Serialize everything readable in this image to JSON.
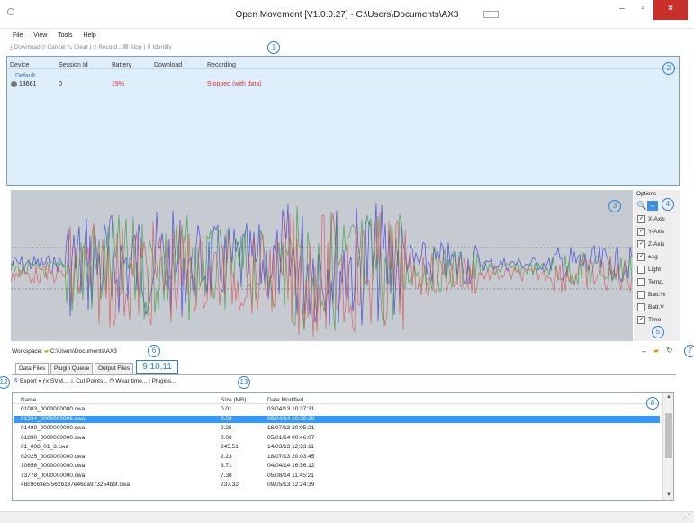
{
  "window": {
    "title": "Open Movement  [V1.0.0.27] - C:\\Users\\Documents\\AX3",
    "minimize": "–",
    "maximize": "▫",
    "close": "×"
  },
  "menu": [
    "File",
    "View",
    "Tools",
    "Help"
  ],
  "toolbar": {
    "download": "Download",
    "cancel": "Cancel",
    "clear": "Clear",
    "record": "Record...",
    "stop": "Stop",
    "identify": "Identify"
  },
  "devices": {
    "columns": [
      "Device",
      "Session Id",
      "Battery",
      "Download",
      "Recording"
    ],
    "group": "Default",
    "rows": [
      {
        "device": "13661",
        "session": "0",
        "battery": "19%",
        "download": "",
        "recording": "Stopped (with data)"
      }
    ]
  },
  "options": {
    "title": "Options",
    "items": [
      {
        "label": "X-Axis",
        "checked": true
      },
      {
        "label": "Y-Axis",
        "checked": true
      },
      {
        "label": "Z-Axis",
        "checked": true
      },
      {
        "label": "±1g",
        "checked": true
      },
      {
        "label": "Light",
        "checked": false
      },
      {
        "label": "Temp.",
        "checked": false
      },
      {
        "label": "Batt.%",
        "checked": false
      },
      {
        "label": "Batt.V",
        "checked": false
      },
      {
        "label": "Time",
        "checked": true
      }
    ]
  },
  "workspace": {
    "label": "Workspace:",
    "path": "C:\\Users\\Documents\\AX3"
  },
  "tabs": [
    "Data Files",
    "Plugin Queue",
    "Output Files"
  ],
  "tab_annotation": "9,10,11",
  "file_toolbar": {
    "export": "Export",
    "svm": "SVM...",
    "cut_points": "Cut Points...",
    "wear_time": "Wear time...",
    "plugins": "Plugins..."
  },
  "files": {
    "columns": [
      "Name",
      "Size (MB)",
      "Date Modified"
    ],
    "rows": [
      {
        "name": "01083_0000000000.cwa",
        "size": "0.01",
        "date": "03/04/13 10:37:31"
      },
      {
        "name": "01234_0000000006.cwa",
        "size": "0.03",
        "date": "09/04/14 10:29:19"
      },
      {
        "name": "01489_0000000000.cwa",
        "size": "2.25",
        "date": "18/07/13 20:05:21"
      },
      {
        "name": "01890_0000000000.cwa",
        "size": "0.00",
        "date": "05/01/14 00:46:07"
      },
      {
        "name": "01_008_01_3.cwa",
        "size": "245.51",
        "date": "14/03/13 12:33:11"
      },
      {
        "name": "02025_0000000000.cwa",
        "size": "2.23",
        "date": "18/07/13 20:03:45"
      },
      {
        "name": "10656_0000000000.cwa",
        "size": "3.71",
        "date": "04/04/14 16:56:12"
      },
      {
        "name": "13778_0000000000.cwa",
        "size": "7.38",
        "date": "05/08/14 11:45:21"
      },
      {
        "name": "48c9c63e5f562b137e46da973254bbf.cwa",
        "size": "237.32",
        "date": "09/05/13 12:24:39"
      }
    ],
    "selected_index": 1
  },
  "annotations": [
    "1",
    "2",
    "3",
    "4",
    "5",
    "6",
    "7",
    "8",
    "12",
    "13"
  ],
  "colors": {
    "selection": "#3399ff",
    "annotation": "#2b7fd7",
    "panel": "#deeefa",
    "plot_bg": "#c5cbd1",
    "x_axis": "#d9534f",
    "y_axis": "#3c9c3c",
    "z_axis": "#3a3ad8",
    "close": "#c9302c",
    "battery_text": "#e0303a"
  }
}
